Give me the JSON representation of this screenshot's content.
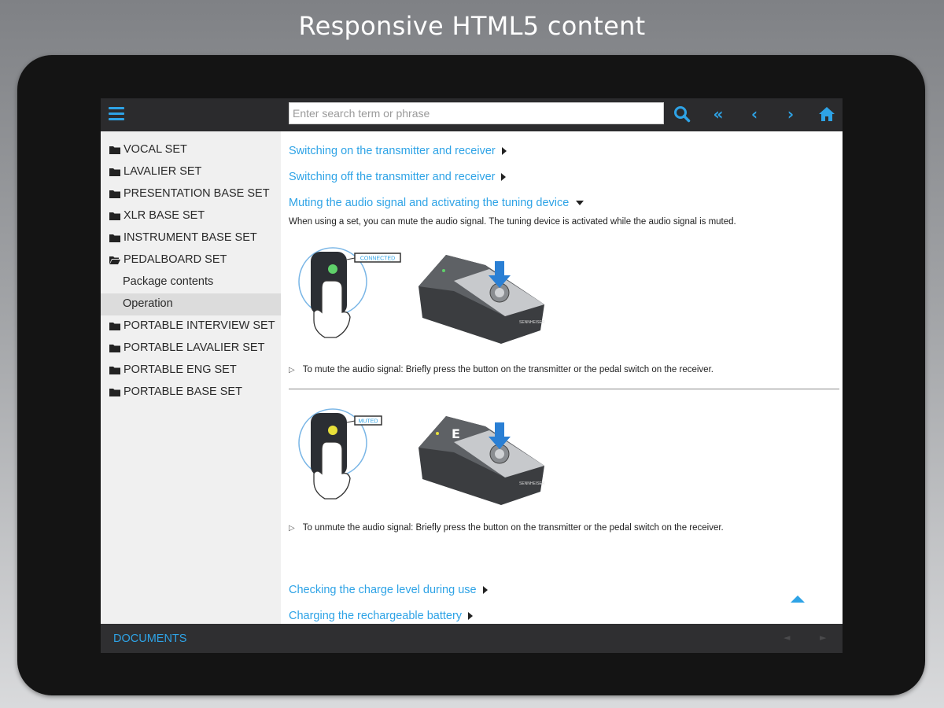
{
  "banner": {
    "title": "Responsive HTML5 content"
  },
  "colors": {
    "accent": "#2ea3e6",
    "toolbar": "#2b2b2d",
    "sidebar": "#f0f0f0"
  },
  "toolbar": {
    "menu_icon": "hamburger-menu-icon",
    "search_placeholder": "Enter search term or phrase",
    "search_value": "",
    "icons": {
      "search": "search-icon",
      "first": "double-chevron-left-icon",
      "prev": "chevron-left-icon",
      "next": "chevron-right-icon",
      "home": "home-icon"
    }
  },
  "sidebar": {
    "items": [
      {
        "label": "VOCAL SET",
        "type": "folder"
      },
      {
        "label": "LAVALIER SET",
        "type": "folder"
      },
      {
        "label": "PRESENTATION BASE SET",
        "type": "folder"
      },
      {
        "label": "XLR BASE SET",
        "type": "folder"
      },
      {
        "label": "INSTRUMENT BASE SET",
        "type": "folder"
      },
      {
        "label": "PEDALBOARD SET",
        "type": "folder-open"
      },
      {
        "label": "Package contents",
        "type": "page"
      },
      {
        "label": "Operation",
        "type": "page",
        "active": true
      },
      {
        "label": "PORTABLE INTERVIEW SET",
        "type": "folder"
      },
      {
        "label": "PORTABLE LAVALIER SET",
        "type": "folder"
      },
      {
        "label": "PORTABLE ENG SET",
        "type": "folder"
      },
      {
        "label": "PORTABLE BASE SET",
        "type": "folder"
      }
    ]
  },
  "content": {
    "topics": [
      {
        "label": "Switching on the transmitter and receiver"
      },
      {
        "label": "Switching off the transmitter and receiver"
      },
      {
        "label": "Muting the audio signal and activating the tuning device"
      }
    ],
    "intro": "When using a set, you can mute the audio signal. The tuning device is activated while the audio signal is muted.",
    "figure1": {
      "status_label": "CONNECTED",
      "brand": "SENNHEISER"
    },
    "step1": "To mute the audio signal: Briefly press the button on the transmitter or the pedal switch on the receiver.",
    "figure2": {
      "status_label": "MUTED",
      "brand": "SENNHEISER",
      "display": "E"
    },
    "step2": "To unmute the audio signal: Briefly press the button on the transmitter or the pedal switch on the receiver.",
    "bottom_topics": [
      {
        "label": "Checking the charge level during use"
      },
      {
        "label": "Charging the rechargeable battery"
      }
    ]
  },
  "footer": {
    "documents_label": "DOCUMENTS"
  }
}
